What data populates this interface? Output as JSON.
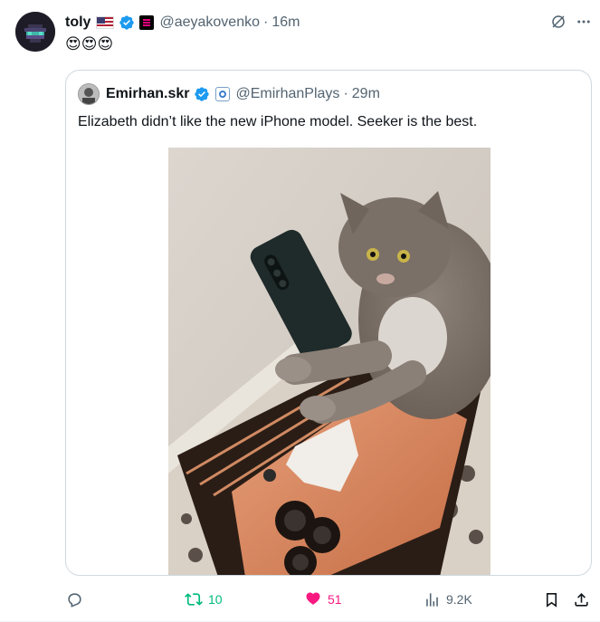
{
  "tweet": {
    "author_name": "toly",
    "handle": "@aeyakovenko",
    "separator": "·",
    "time": "16m",
    "text": "😍😍😍"
  },
  "quoted": {
    "author_name": "Emirhan.skr",
    "handle": "@EmirhanPlays",
    "separator": "·",
    "time": "29m",
    "text": "Elizabeth didn’t like the new iPhone model. Seeker is the best."
  },
  "actions": {
    "replies": "",
    "retweets": "10",
    "likes": "51",
    "views": "9.2K"
  },
  "colors": {
    "retweet": "#00ba7c",
    "like": "#f91880",
    "verified": "#1d9bf0",
    "muted": "#536471"
  },
  "icons": [
    "verified-badge-icon",
    "us-flag-icon",
    "affiliate-badge-icon",
    "grok-icon",
    "more-icon",
    "reply-icon",
    "retweet-icon",
    "like-icon",
    "views-icon",
    "bookmark-icon",
    "share-icon"
  ]
}
